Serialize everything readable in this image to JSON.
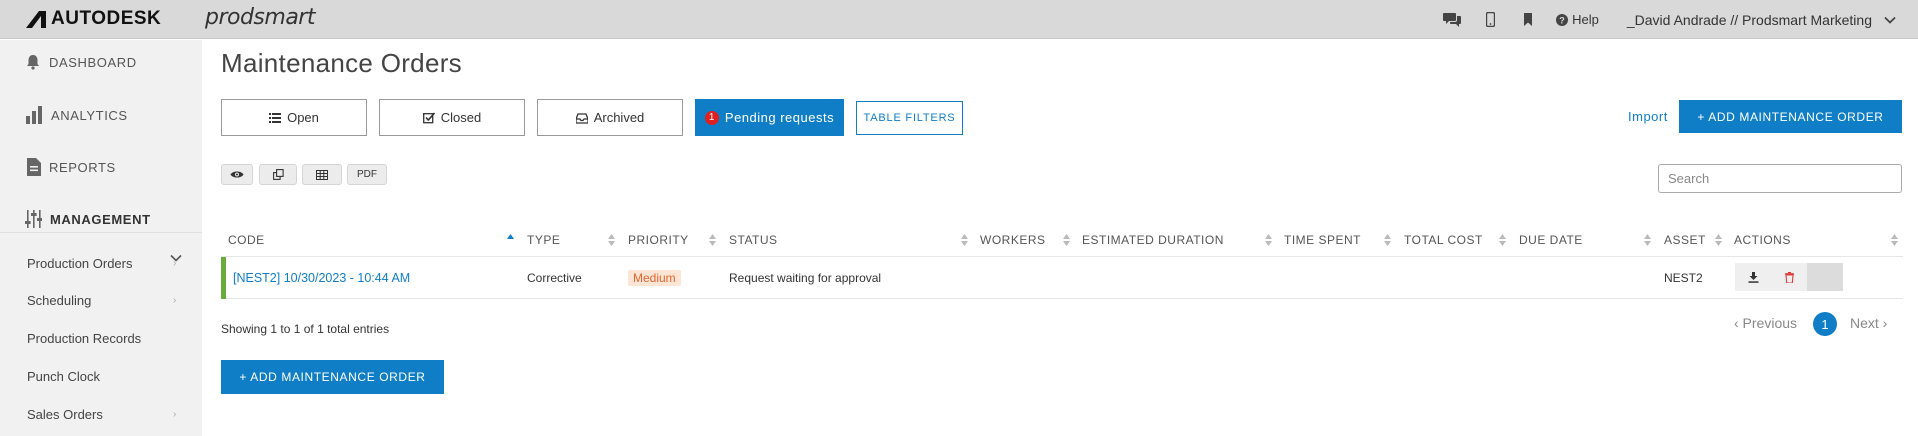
{
  "topbar": {
    "brand": "AUTODESK",
    "product": "prodsmart",
    "icons": [
      "chat-icon",
      "mobile-icon",
      "bookmark-icon"
    ],
    "help_label": "Help",
    "user": "_David Andrade // Prodsmart Marketing"
  },
  "sidebar": {
    "main_items": [
      {
        "label": "DASHBOARD",
        "icon": "bell-icon"
      },
      {
        "label": "ANALYTICS",
        "icon": "bar-chart-icon"
      },
      {
        "label": "REPORTS",
        "icon": "document-icon"
      },
      {
        "label": "MANAGEMENT",
        "icon": "sliders-icon"
      }
    ],
    "sub_items": [
      {
        "label": "Production Orders",
        "has_arrow": true
      },
      {
        "label": "Scheduling",
        "has_arrow": true
      },
      {
        "label": "Production Records",
        "has_arrow": false
      },
      {
        "label": "Punch Clock",
        "has_arrow": false
      },
      {
        "label": "Sales Orders",
        "has_arrow": true
      }
    ]
  },
  "page": {
    "title": "Maintenance Orders",
    "tabs": {
      "open": "Open",
      "closed": "Closed",
      "archived": "Archived",
      "pending": "Pending requests",
      "pending_count": "1"
    },
    "filters_label": "TABLE FILTERS",
    "import_label": "Import",
    "add_label": "+ ADD MAINTENANCE ORDER",
    "tools": {
      "pdf": "PDF"
    },
    "search_placeholder": "Search"
  },
  "table": {
    "headers": {
      "code": "CODE",
      "type": "TYPE",
      "priority": "PRIORITY",
      "status": "STATUS",
      "workers": "WORKERS",
      "duration": "ESTIMATED DURATION",
      "spent": "TIME SPENT",
      "cost": "TOTAL COST",
      "due": "DUE DATE",
      "asset": "ASSET",
      "actions": "ACTIONS"
    },
    "rows": [
      {
        "code": "[NEST2] 10/30/2023 - 10:44 AM",
        "type": "Corrective",
        "priority": "Medium",
        "status": "Request waiting for approval",
        "workers": "",
        "duration": "",
        "spent": "",
        "cost": "",
        "due": "",
        "asset": "NEST2"
      }
    ]
  },
  "footer": {
    "showing": "Showing 1 to 1 of 1 total entries",
    "prev": "‹ Previous",
    "current_page": "1",
    "next": "Next ›"
  },
  "colors": {
    "primary": "#0f7ec6",
    "badge_red": "#e02020",
    "row_accent": "#6aaa3c",
    "priority_bg": "#fde5d6",
    "priority_text": "#e0662e"
  }
}
